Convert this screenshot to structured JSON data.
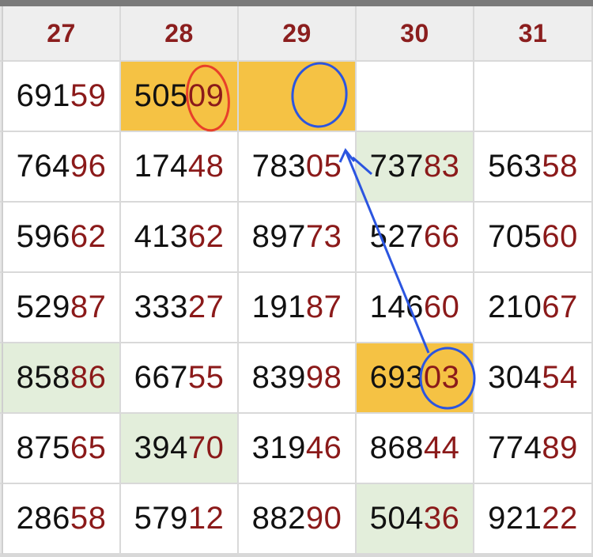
{
  "header": [
    "27",
    "28",
    "29",
    "30",
    "31"
  ],
  "rows": [
    [
      {
        "pre": "691",
        "suf": "59",
        "bg": "white"
      },
      {
        "pre": "505",
        "suf": "09",
        "bg": "gold"
      },
      {
        "pre": "",
        "suf": "",
        "bg": "gold"
      },
      {
        "pre": "",
        "suf": "",
        "bg": "white"
      },
      {
        "pre": "",
        "suf": "",
        "bg": "white"
      }
    ],
    [
      {
        "pre": "764",
        "suf": "96",
        "bg": "white"
      },
      {
        "pre": "174",
        "suf": "48",
        "bg": "white"
      },
      {
        "pre": "783",
        "suf": "05",
        "bg": "white"
      },
      {
        "pre": "737",
        "suf": "83",
        "bg": "green"
      },
      {
        "pre": "563",
        "suf": "58",
        "bg": "white"
      }
    ],
    [
      {
        "pre": "596",
        "suf": "62",
        "bg": "white"
      },
      {
        "pre": "413",
        "suf": "62",
        "bg": "white"
      },
      {
        "pre": "897",
        "suf": "73",
        "bg": "white"
      },
      {
        "pre": "527",
        "suf": "66",
        "bg": "white"
      },
      {
        "pre": "705",
        "suf": "60",
        "bg": "white"
      }
    ],
    [
      {
        "pre": "529",
        "suf": "87",
        "bg": "white"
      },
      {
        "pre": "333",
        "suf": "27",
        "bg": "white"
      },
      {
        "pre": "191",
        "suf": "87",
        "bg": "white"
      },
      {
        "pre": "146",
        "suf": "60",
        "bg": "white"
      },
      {
        "pre": "210",
        "suf": "67",
        "bg": "white"
      }
    ],
    [
      {
        "pre": "858",
        "suf": "86",
        "bg": "green"
      },
      {
        "pre": "667",
        "suf": "55",
        "bg": "white"
      },
      {
        "pre": "839",
        "suf": "98",
        "bg": "white"
      },
      {
        "pre": "693",
        "suf": "03",
        "bg": "gold"
      },
      {
        "pre": "304",
        "suf": "54",
        "bg": "white"
      }
    ],
    [
      {
        "pre": "875",
        "suf": "65",
        "bg": "white"
      },
      {
        "pre": "394",
        "suf": "70",
        "bg": "green"
      },
      {
        "pre": "319",
        "suf": "46",
        "bg": "white"
      },
      {
        "pre": "868",
        "suf": "44",
        "bg": "white"
      },
      {
        "pre": "774",
        "suf": "89",
        "bg": "white"
      }
    ],
    [
      {
        "pre": "286",
        "suf": "58",
        "bg": "white"
      },
      {
        "pre": "579",
        "suf": "12",
        "bg": "white"
      },
      {
        "pre": "882",
        "suf": "90",
        "bg": "white"
      },
      {
        "pre": "504",
        "suf": "36",
        "bg": "green"
      },
      {
        "pre": "921",
        "suf": "22",
        "bg": "white"
      }
    ]
  ],
  "edge_green_rows": [
    4
  ],
  "colors": {
    "header_text": "#8b1e1e",
    "digit_suffix": "#8b1a1a",
    "highlight_gold": "#f5c244",
    "highlight_green": "#e3eedb",
    "annotation_red": "#e8402a",
    "annotation_blue": "#2b55e0"
  },
  "annotations": [
    {
      "type": "circle",
      "color": "red",
      "target": "row-1-col-28"
    },
    {
      "type": "circle",
      "color": "blue",
      "target": "row-1-col-29"
    },
    {
      "type": "circle",
      "color": "blue",
      "target": "row-5-col-30"
    },
    {
      "type": "arrow",
      "color": "blue",
      "from": "row-5-col-30",
      "to": "row-2-col-29"
    }
  ]
}
